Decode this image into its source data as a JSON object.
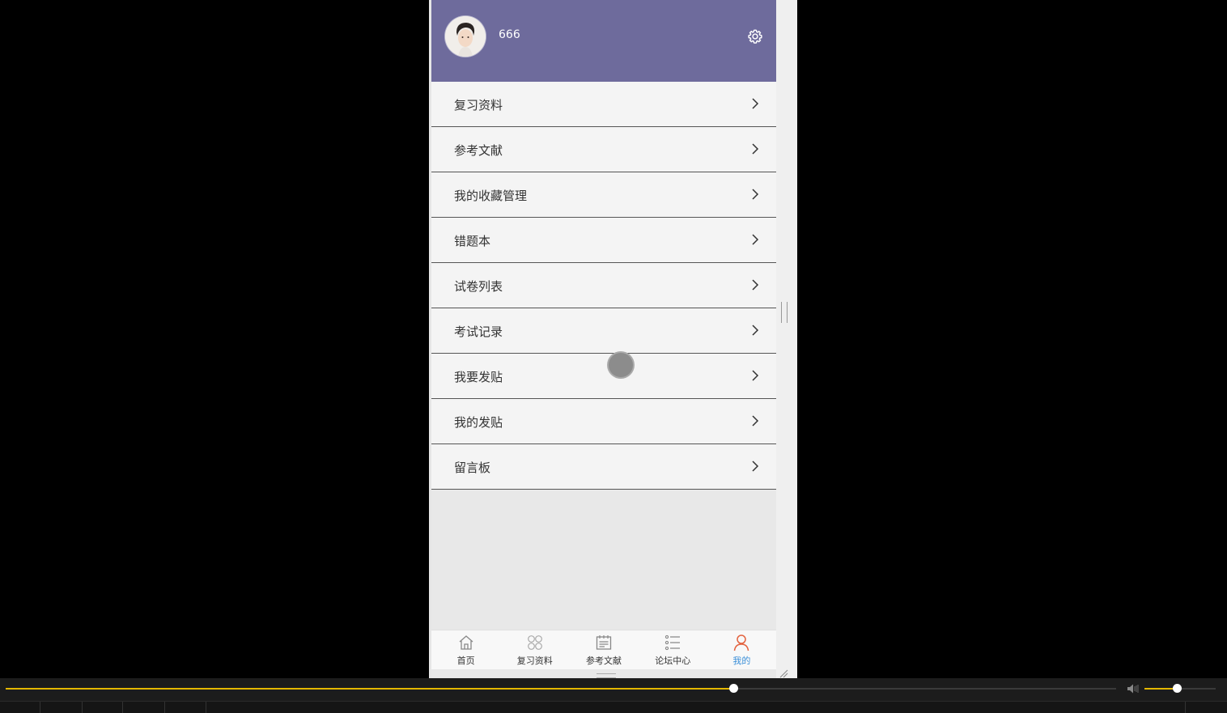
{
  "profile": {
    "username": "666"
  },
  "menu": [
    {
      "label": "复习资料"
    },
    {
      "label": "参考文献"
    },
    {
      "label": "我的收藏管理"
    },
    {
      "label": "错题本"
    },
    {
      "label": "试卷列表"
    },
    {
      "label": "考试记录"
    },
    {
      "label": "我要发贴"
    },
    {
      "label": "我的发贴"
    },
    {
      "label": "留言板"
    }
  ],
  "tabbar": [
    {
      "label": "首页",
      "icon": "home-icon"
    },
    {
      "label": "复习资料",
      "icon": "grid-icon"
    },
    {
      "label": "参考文献",
      "icon": "document-icon"
    },
    {
      "label": "论坛中心",
      "icon": "list-icon"
    },
    {
      "label": "我的",
      "icon": "user-icon",
      "active": true
    }
  ],
  "player": {
    "progress_fraction": 0.655,
    "volume_fraction": 0.45
  },
  "colors": {
    "header_bg": "#6e6b9c",
    "active_tab": "#3b8fd8",
    "active_tab_icon": "#e3623e",
    "progress": "#e5b800"
  }
}
